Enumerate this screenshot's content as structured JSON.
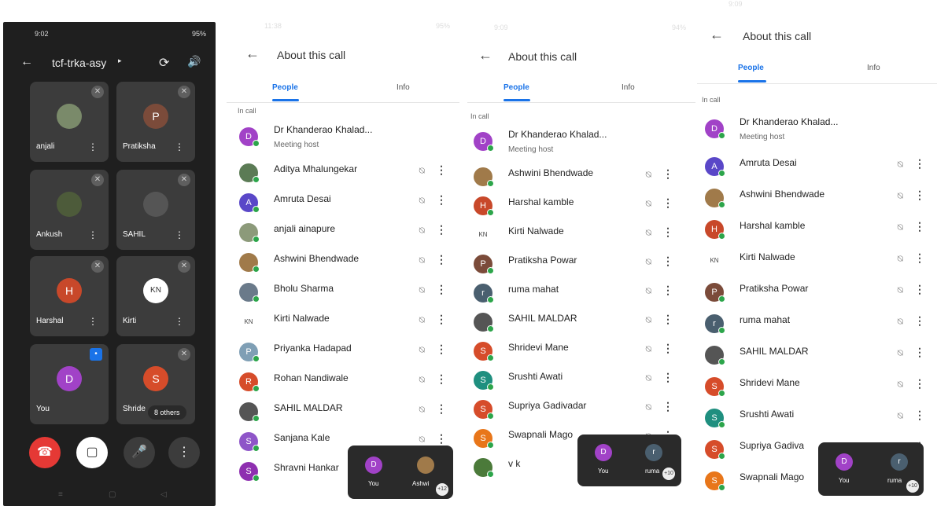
{
  "panel1": {
    "status_time": "9:02",
    "status_right": "95%",
    "meeting_code": "tcf-trka-asy",
    "tiles": [
      {
        "name": "anjali",
        "initial": "",
        "color": "#7a8a6a"
      },
      {
        "name": "Pratiksha",
        "initial": "P",
        "color": "#7b4b3a"
      },
      {
        "name": "Ankush",
        "initial": "",
        "color": "#4d5b3a"
      },
      {
        "name": "SAHIL",
        "initial": "",
        "color": "#555555"
      },
      {
        "name": "Harshal",
        "initial": "H",
        "color": "#c8482a"
      },
      {
        "name": "Kirti",
        "initial": "KN",
        "color": "#ffffff"
      },
      {
        "name": "You",
        "initial": "D",
        "color": "#a142c7"
      },
      {
        "name": "Shride",
        "initial": "S",
        "color": "#d64c2a"
      }
    ],
    "others_label": "8 others"
  },
  "panel2": {
    "status_time": "11:38",
    "status_right": "95%",
    "title": "About this call",
    "tab_people": "People",
    "tab_info": "Info",
    "in_call": "In call",
    "host_sub": "Meeting host",
    "rows": [
      {
        "name": "Dr Khanderao Khalad...",
        "initial": "D",
        "color": "#a142c7"
      },
      {
        "name": "Aditya Mhalungekar",
        "initial": "",
        "color": "#5b7b55"
      },
      {
        "name": "Amruta Desai",
        "initial": "A",
        "color": "#5a47c8"
      },
      {
        "name": "anjali ainapure",
        "initial": "",
        "color": "#8c9a7a"
      },
      {
        "name": "Ashwini Bhendwade",
        "initial": "",
        "color": "#a07a4a"
      },
      {
        "name": "Bholu Sharma",
        "initial": "",
        "color": "#6a7a8a"
      },
      {
        "name": "Kirti Nalwade",
        "initial": "KN",
        "color": "#ffffff"
      },
      {
        "name": "Priyanka Hadapad",
        "initial": "P",
        "color": "#7f9fb5"
      },
      {
        "name": "Rohan Nandiwale",
        "initial": "R",
        "color": "#d64c2a"
      },
      {
        "name": "SAHIL MALDAR",
        "initial": "",
        "color": "#555555"
      },
      {
        "name": "Sanjana Kale",
        "initial": "S",
        "color": "#8e55c8"
      },
      {
        "name": "Shravni Hankar",
        "initial": "S",
        "color": "#8e2fb0"
      }
    ],
    "pip_you": "You",
    "pip_other": "Ashwi",
    "pip_count": "+12"
  },
  "panel3": {
    "status_time": "9:09",
    "status_right": "94%",
    "title": "About this call",
    "tab_people": "People",
    "tab_info": "Info",
    "in_call": "In call",
    "host_sub": "Meeting host",
    "rows": [
      {
        "name": "Dr Khanderao Khalad...",
        "initial": "D",
        "color": "#a142c7"
      },
      {
        "name": "Ashwini Bhendwade",
        "initial": "",
        "color": "#a07a4a"
      },
      {
        "name": "Harshal kamble",
        "initial": "H",
        "color": "#c8482a"
      },
      {
        "name": "Kirti Nalwade",
        "initial": "KN",
        "color": "#ffffff"
      },
      {
        "name": "Pratiksha Powar",
        "initial": "P",
        "color": "#7b4b3a"
      },
      {
        "name": "ruma mahat",
        "initial": "r",
        "color": "#4a5f6f"
      },
      {
        "name": "SAHIL MALDAR",
        "initial": "",
        "color": "#555555"
      },
      {
        "name": "Shridevi Mane",
        "initial": "S",
        "color": "#d64c2a"
      },
      {
        "name": "Srushti Awati",
        "initial": "S",
        "color": "#1f8f7f"
      },
      {
        "name": "Supriya Gadivadar",
        "initial": "S",
        "color": "#d64c2a"
      },
      {
        "name": "Swapnali Mago",
        "initial": "S",
        "color": "#e8761a"
      },
      {
        "name": "v k",
        "initial": "",
        "color": "#4b7a3a"
      }
    ],
    "pip_you": "You",
    "pip_other": "ruma",
    "pip_count": "+10"
  },
  "panel4": {
    "status_time": "9:09",
    "title": "About this call",
    "tab_people": "People",
    "tab_info": "Info",
    "in_call": "In call",
    "host_sub": "Meeting host",
    "rows": [
      {
        "name": "Dr Khanderao Khalad...",
        "initial": "D",
        "color": "#a142c7"
      },
      {
        "name": "Amruta Desai",
        "initial": "A",
        "color": "#5a47c8"
      },
      {
        "name": "Ashwini Bhendwade",
        "initial": "",
        "color": "#a07a4a"
      },
      {
        "name": "Harshal kamble",
        "initial": "H",
        "color": "#c8482a"
      },
      {
        "name": "Kirti Nalwade",
        "initial": "KN",
        "color": "#ffffff"
      },
      {
        "name": "Pratiksha Powar",
        "initial": "P",
        "color": "#7b4b3a"
      },
      {
        "name": "ruma mahat",
        "initial": "r",
        "color": "#4a5f6f"
      },
      {
        "name": "SAHIL MALDAR",
        "initial": "",
        "color": "#555555"
      },
      {
        "name": "Shridevi Mane",
        "initial": "S",
        "color": "#d64c2a"
      },
      {
        "name": "Srushti Awati",
        "initial": "S",
        "color": "#1f8f7f"
      },
      {
        "name": "Supriya Gadiva",
        "initial": "S",
        "color": "#d64c2a"
      },
      {
        "name": "Swapnali Mago",
        "initial": "S",
        "color": "#e8761a"
      }
    ],
    "pip_you": "You",
    "pip_other": "ruma",
    "pip_count": "+10"
  }
}
